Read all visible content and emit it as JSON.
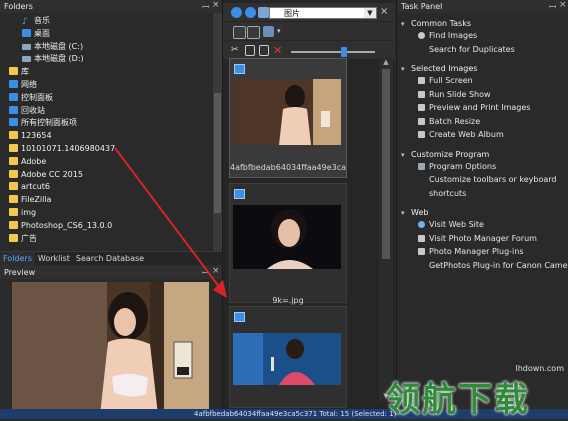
{
  "folders": {
    "title": "Folders",
    "pin_icon": "pin-icon",
    "close_icon": "close-icon",
    "tree": [
      {
        "label": "音乐",
        "icon": "music-icon",
        "indent": 2
      },
      {
        "label": "桌面",
        "icon": "desktop-icon",
        "indent": 2
      },
      {
        "label": "本地磁盘 (C:)",
        "icon": "disk-icon",
        "indent": 2
      },
      {
        "label": "本地磁盘 (D:)",
        "icon": "disk-icon",
        "indent": 2
      },
      {
        "label": "库",
        "icon": "library-icon",
        "indent": 1
      },
      {
        "label": "网络",
        "icon": "network-icon",
        "indent": 1
      },
      {
        "label": "控制面板",
        "icon": "control-panel-icon",
        "indent": 1
      },
      {
        "label": "回收站",
        "icon": "recycle-bin-icon",
        "indent": 1
      },
      {
        "label": "所有控制面板项",
        "icon": "control-panel-icon",
        "indent": 1
      },
      {
        "label": "123654",
        "icon": "folder-icon",
        "indent": 1
      },
      {
        "label": "10101071.1406980437",
        "icon": "folder-icon",
        "indent": 1
      },
      {
        "label": "Adobe",
        "icon": "folder-icon",
        "indent": 1
      },
      {
        "label": "Adobe CC 2015",
        "icon": "folder-icon",
        "indent": 1
      },
      {
        "label": "artcut6",
        "icon": "folder-icon",
        "indent": 1
      },
      {
        "label": "FileZilla",
        "icon": "folder-icon",
        "indent": 1
      },
      {
        "label": "img",
        "icon": "folder-icon",
        "indent": 1
      },
      {
        "label": "Photoshop_CS6_13.0.0",
        "icon": "folder-icon",
        "indent": 1
      },
      {
        "label": "广告",
        "icon": "folder-icon",
        "indent": 1
      }
    ],
    "tabs": [
      "Folders",
      "Worklist",
      "Search Database"
    ]
  },
  "preview": {
    "title": "Preview"
  },
  "middle": {
    "location": "图片",
    "thumbnails": [
      {
        "label": "4afbfbedab64034ffaa49e3ca...",
        "selected": true
      },
      {
        "label": "9k=.jpg",
        "selected": false
      },
      {
        "label": "",
        "selected": false
      }
    ]
  },
  "task_panel": {
    "title": "Task Panel",
    "sections": [
      {
        "title": "Common Tasks",
        "items": [
          {
            "label": "Find Images",
            "icon": "search-icon"
          },
          {
            "label": "Search for Duplicates",
            "icon": ""
          }
        ]
      },
      {
        "title": "Selected Images",
        "items": [
          {
            "label": "Full Screen",
            "icon": "fullscreen-icon"
          },
          {
            "label": "Run Slide Show",
            "icon": "slideshow-icon"
          },
          {
            "label": "Preview and Print Images",
            "icon": "print-icon"
          },
          {
            "label": "Batch Resize",
            "icon": "resize-icon"
          },
          {
            "label": "Create Web Album",
            "icon": "web-album-icon"
          }
        ]
      },
      {
        "title": "Customize Program",
        "items": [
          {
            "label": "Program Options",
            "icon": "gear-icon"
          },
          {
            "label": "Customize toolbars or keyboard",
            "icon": ""
          },
          {
            "label": "shortcuts",
            "icon": ""
          }
        ]
      },
      {
        "title": "Web",
        "items": [
          {
            "label": "Visit Web Site",
            "icon": "globe-icon"
          },
          {
            "label": "Visit Photo Manager Forum",
            "icon": "forum-icon"
          },
          {
            "label": "Photo Manager Plug-ins",
            "icon": "plugin-icon"
          },
          {
            "label": "GetPhotos Plug-in for Canon Cameras",
            "icon": ""
          }
        ]
      }
    ]
  },
  "status": {
    "text": "4afbfbedab64034ffaa49e3ca5c371  Total: 15 (Selected: 1)"
  },
  "watermark": {
    "site": "lhdown.com",
    "brand": "领航下载"
  },
  "colors": {
    "accent": "#3b8fe6",
    "arrow": "#d8232a",
    "watermark": "#2e8b3a"
  }
}
